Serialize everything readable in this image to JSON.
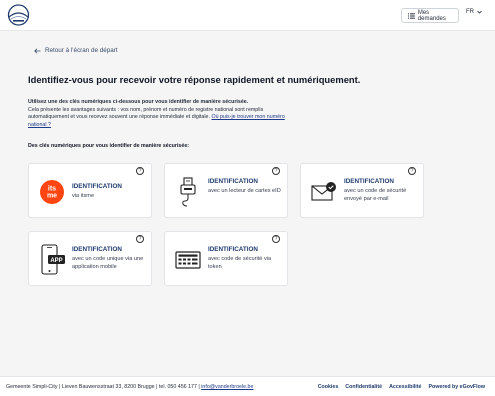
{
  "header": {
    "mes_demandes": "Mes demandes",
    "lang": "FR"
  },
  "back_label": "Retour à l'écran de départ",
  "title": "Identifiez-vous pour recevoir votre réponse rapidement et numériquement.",
  "intro": {
    "bold": "Utilisez une des clés numériques ci-dessous pour vous identifier de manière sécurisée.",
    "text": "Cela présente les avantages suivants : vos nom, prénom et numéro de registre national sont remplis automatiquement et vous recevez souvent une réponse immédiate et digitale.",
    "link": "Où puis-je trouver mon numéro national ?"
  },
  "keys_heading": "Des clés numériques pour vous identifier de manière sécurisée:",
  "cards": [
    {
      "title": "IDENTIFICATION",
      "desc": "via itsme",
      "icon": "itsme-logo",
      "itsme_text_1": "its",
      "itsme_text_2": "me"
    },
    {
      "title": "IDENTIFICATION",
      "desc": "avec un lecteur de cartes eID",
      "icon": "card-reader-icon"
    },
    {
      "title": "IDENTIFICATION",
      "desc": "avec un code de sécurité envoyé par e-mail",
      "icon": "email-check-icon"
    },
    {
      "title": "IDENTIFICATION",
      "desc": "avec un code unique via une application mobile",
      "icon": "mobile-app-icon",
      "app_label": "APP"
    },
    {
      "title": "IDENTIFICATION",
      "desc": "avec code de sécurité via token",
      "icon": "token-icon"
    }
  ],
  "help_glyph": "?",
  "footer": {
    "left": "Gemeente Simpli-City | Lieven Bauwensstraat 33, 8200 Brugge | tel. 050 456 177 |",
    "email": "info@vanderbroele.be",
    "links": [
      "Cookies",
      "Confidentialité",
      "Accessibilité",
      "Powered by eGovFlow"
    ]
  },
  "colors": {
    "accent": "#1e3a6e",
    "itsme": "#ff4612",
    "background": "#f5f5f5"
  }
}
